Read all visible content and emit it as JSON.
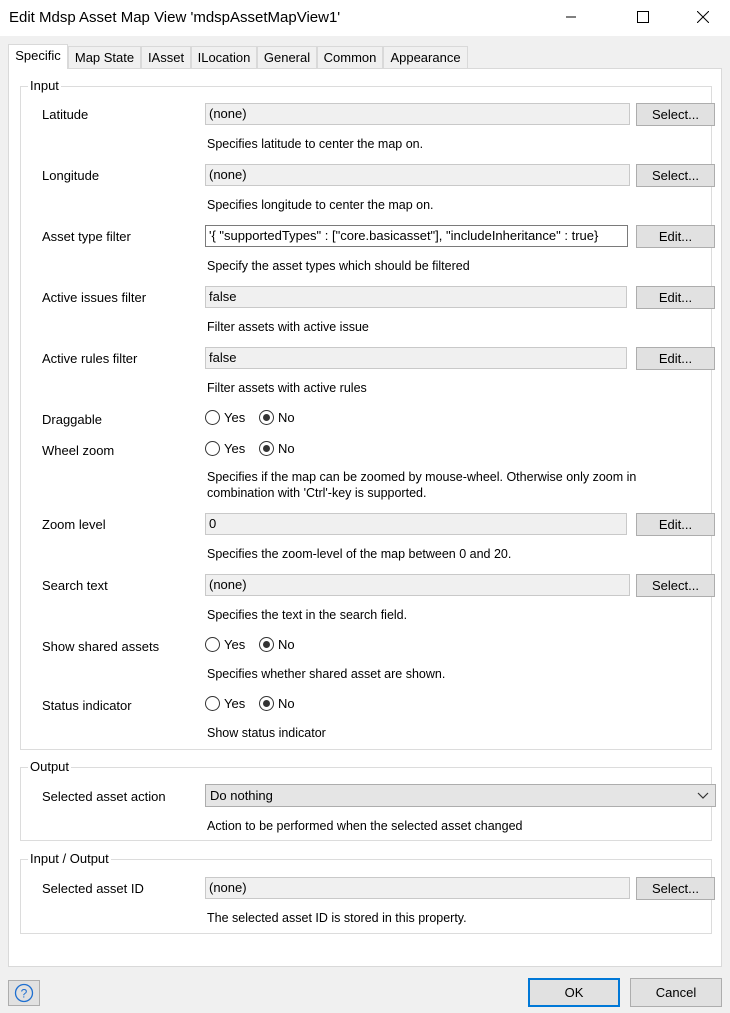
{
  "window": {
    "title": "Edit Mdsp Asset Map View 'mdspAssetMapView1'"
  },
  "tabs": [
    {
      "label": "Specific",
      "active": true
    },
    {
      "label": "Map State"
    },
    {
      "label": "IAsset"
    },
    {
      "label": "ILocation"
    },
    {
      "label": "General"
    },
    {
      "label": "Common"
    },
    {
      "label": "Appearance"
    }
  ],
  "input_group": {
    "label": "Input",
    "latitude": {
      "label": "Latitude",
      "value": "(none)",
      "button": "Select...",
      "desc": "Specifies latitude to center the map on."
    },
    "longitude": {
      "label": "Longitude",
      "value": "(none)",
      "button": "Select...",
      "desc": "Specifies longitude to center the map on."
    },
    "asset_type_filter": {
      "label": "Asset type filter",
      "value": "'{   \"supportedTypes\" : [\"core.basicasset\"],   \"includeInheritance\" : true}",
      "button": "Edit...",
      "desc": "Specify the asset types which should be filtered"
    },
    "active_issues": {
      "label": "Active issues filter",
      "value": "false",
      "button": "Edit...",
      "desc": "Filter assets with active issue"
    },
    "active_rules": {
      "label": "Active rules filter",
      "value": "false",
      "button": "Edit...",
      "desc": "Filter assets with active rules"
    },
    "draggable": {
      "label": "Draggable",
      "yes": "Yes",
      "no": "No",
      "selected": "No"
    },
    "wheel_zoom": {
      "label": "Wheel zoom",
      "yes": "Yes",
      "no": "No",
      "selected": "No",
      "desc_line1": "Specifies if the map can be zoomed by mouse-wheel. Otherwise only zoom in",
      "desc_line2": "combination with 'Ctrl'-key is supported."
    },
    "zoom_level": {
      "label": "Zoom level",
      "value": "0",
      "button": "Edit...",
      "desc": "Specifies the zoom-level of the map between 0 and 20."
    },
    "search_text": {
      "label": "Search text",
      "value": "(none)",
      "button": "Select...",
      "desc": "Specifies the text in the search field."
    },
    "show_shared": {
      "label": "Show shared assets",
      "yes": "Yes",
      "no": "No",
      "selected": "No",
      "desc": "Specifies whether shared asset are shown."
    },
    "status_indicator": {
      "label": "Status indicator",
      "yes": "Yes",
      "no": "No",
      "selected": "No",
      "desc": "Show status indicator"
    }
  },
  "output_group": {
    "label": "Output",
    "selected_action": {
      "label": "Selected asset action",
      "value": "Do nothing",
      "desc": "Action to be performed when the selected asset changed"
    }
  },
  "io_group": {
    "label": "Input / Output",
    "selected_id": {
      "label": "Selected asset ID",
      "value": "(none)",
      "button": "Select...",
      "desc": "The selected asset ID is stored in this property."
    }
  },
  "footer": {
    "ok": "OK",
    "cancel": "Cancel"
  },
  "colors": {
    "accent": "#0078d7",
    "help": "#1e6fd0"
  }
}
